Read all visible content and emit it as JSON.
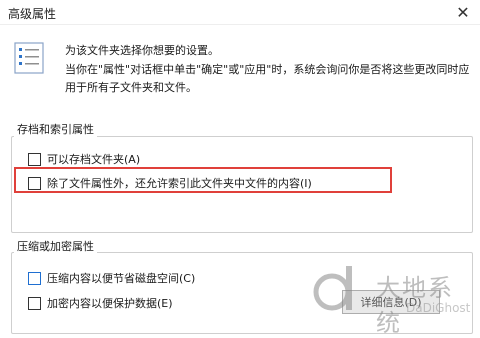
{
  "window": {
    "title": "高级属性",
    "close_glyph": "✕"
  },
  "intro": {
    "line1": "为该文件夹选择你想要的设置。",
    "line2": "当你在\"属性\"对话框中单击\"确定\"或\"应用\"时，系统会询问你是否将这些更改同时应用于所有子文件夹和文件。",
    "icon": "properties-list-icon"
  },
  "archive_group": {
    "title": "存档和索引属性",
    "archive_label": "可以存档文件夹(A)",
    "archive_checked": false,
    "index_label": "除了文件属性外，还允许索引此文件夹中文件的内容(I)",
    "index_checked": false
  },
  "compress_group": {
    "title": "压缩或加密属性",
    "compress_label": "压缩内容以便节省磁盘空间(C)",
    "compress_checked": false,
    "encrypt_label": "加密内容以便保护数据(E)",
    "encrypt_checked": false,
    "details_button": "详细信息(D)"
  },
  "watermark": {
    "text": "大地系统",
    "sub": "DaDiGhost"
  },
  "colors": {
    "highlight": "#e0403a",
    "accent": "#1f6fd1"
  }
}
